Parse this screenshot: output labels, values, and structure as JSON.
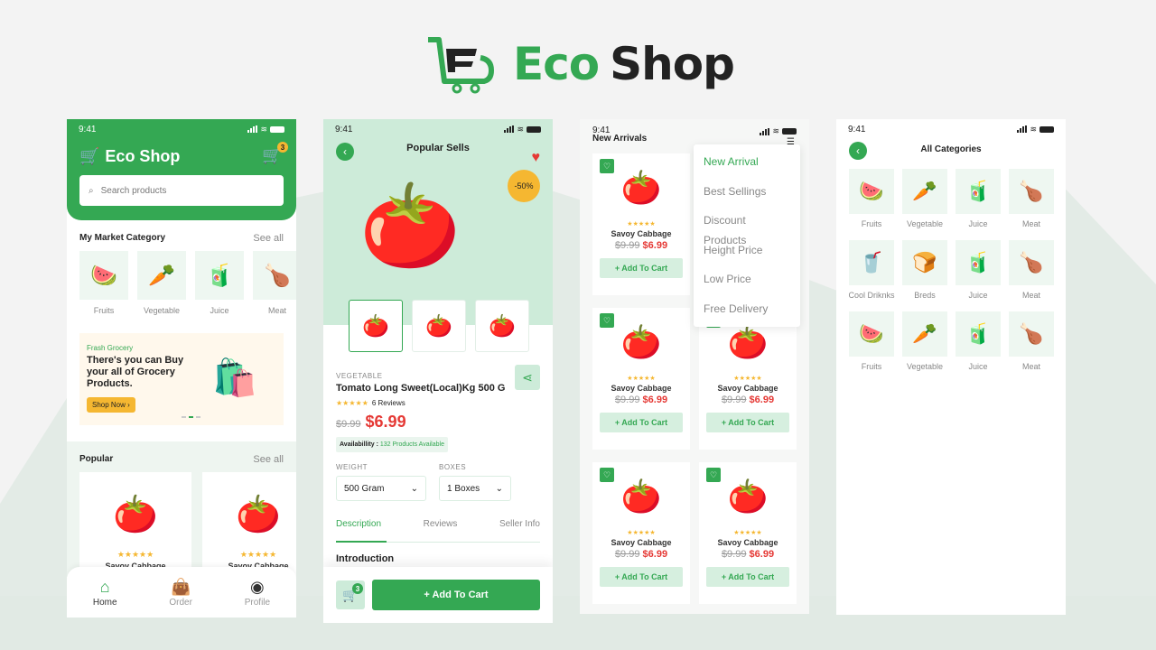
{
  "brand": {
    "name_part1": "Eco",
    "name_part2": "Shop",
    "accent": "#34a853"
  },
  "status_time": "9:41",
  "home": {
    "logo_text": "Eco Shop",
    "cart_count": "3",
    "search_placeholder": "Search products",
    "category_section": {
      "title": "My Market Category",
      "see_all": "See all"
    },
    "categories": [
      {
        "label": "Fruits",
        "icon": "🍉"
      },
      {
        "label": "Vegetable",
        "icon": "🥕"
      },
      {
        "label": "Juice",
        "icon": "🧃"
      },
      {
        "label": "Meat",
        "icon": "🍗"
      }
    ],
    "banner": {
      "subtitle": "Frash Grocery",
      "headline": "There's you can Buy your all of Grocery Products.",
      "button": "Shop Now ›",
      "image_icon": "🛍️"
    },
    "popular_section": {
      "title": "Popular",
      "see_all": "See all"
    },
    "popular_items": [
      {
        "name": "Savoy Cabbage",
        "stars": "★★★★★",
        "icon": "🍅"
      },
      {
        "name": "Savoy Cabbage",
        "stars": "★★★★★",
        "icon": "🍅"
      }
    ],
    "nav": [
      {
        "label": "Home",
        "icon": "⌂"
      },
      {
        "label": "Order",
        "icon": "👜"
      },
      {
        "label": "Profile",
        "icon": "◉"
      }
    ]
  },
  "detail": {
    "title": "Popular Sells",
    "discount": "-50%",
    "hero_icon": "🍅",
    "thumbs": [
      "🍅",
      "🍅",
      "🍅"
    ],
    "category": "VEGETABLE",
    "product_name": "Tomato Long Sweet(Local)Kg 500 G",
    "stars": "★★★★★",
    "reviews": "6 Reviews",
    "old_price": "$9.99",
    "new_price": "$6.99",
    "availability_label": "Availabillity :",
    "availability_value": "132 Products Available",
    "weight_label": "WEIGHT",
    "weight_value": "500 Gram",
    "boxes_label": "BOXES",
    "boxes_value": "1 Boxes",
    "tabs": [
      "Description",
      "Reviews",
      "Seller Info"
    ],
    "intro_heading": "Introduction",
    "cart_count": "3",
    "add_to_cart": "+ Add To Cart"
  },
  "arrivals": {
    "title": "New Arrivals",
    "filter_options": [
      "New Arrival",
      "Best Sellings",
      "Discount Products",
      "Height Price",
      "Low Price",
      "Free Delivery"
    ],
    "products": [
      {
        "name": "Savoy Cabbage",
        "old_price": "$9.99",
        "new_price": "$6.99",
        "stars": "★★★★★",
        "button": "+ Add To Cart"
      },
      {
        "name": "Savoy Cabbage",
        "old_price": "$9.99",
        "new_price": "$6.99",
        "stars": "★★★★★",
        "button": "+ Add To Cart"
      },
      {
        "name": "Savoy Cabbage",
        "old_price": "$9.99",
        "new_price": "$6.99",
        "stars": "★★★★★",
        "button": "+ Add To Cart"
      },
      {
        "name": "Savoy Cabbage",
        "old_price": "$9.99",
        "new_price": "$6.99",
        "stars": "★★★★★",
        "button": "+ Add To Cart"
      },
      {
        "name": "Savoy Cabbage",
        "old_price": "$9.99",
        "new_price": "$6.99",
        "stars": "★★★★★",
        "button": "+ Add To Cart"
      },
      {
        "name": "Savoy Cabbage",
        "old_price": "$9.99",
        "new_price": "$6.99",
        "stars": "★★★★★",
        "button": "+ Add To Cart"
      }
    ]
  },
  "all_categories": {
    "title": "All Categories",
    "items": [
      {
        "label": "Fruits",
        "icon": "🍉"
      },
      {
        "label": "Vegetable",
        "icon": "🥕"
      },
      {
        "label": "Juice",
        "icon": "🧃"
      },
      {
        "label": "Meat",
        "icon": "🍗"
      },
      {
        "label": "Cool Driknks",
        "icon": "🥤"
      },
      {
        "label": "Breds",
        "icon": "🍞"
      },
      {
        "label": "Juice",
        "icon": "🧃"
      },
      {
        "label": "Meat",
        "icon": "🍗"
      },
      {
        "label": "Fruits",
        "icon": "🍉"
      },
      {
        "label": "Vegetable",
        "icon": "🥕"
      },
      {
        "label": "Juice",
        "icon": "🧃"
      },
      {
        "label": "Meat",
        "icon": "🍗"
      }
    ]
  }
}
